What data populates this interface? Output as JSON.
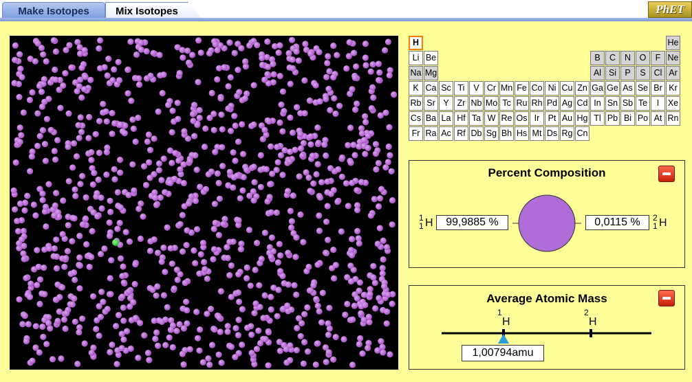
{
  "tabs": [
    {
      "label": "Make Isotopes",
      "active": false
    },
    {
      "label": "Mix Isotopes",
      "active": true
    }
  ],
  "logo": "PhET",
  "periodic_table": {
    "selected": "H",
    "rows": [
      [
        "H",
        "",
        "",
        "",
        "",
        "",
        "",
        "",
        "",
        "",
        "",
        "",
        "",
        "",
        "",
        "",
        "",
        "He"
      ],
      [
        "Li",
        "Be",
        "",
        "",
        "",
        "",
        "",
        "",
        "",
        "",
        "",
        "",
        "B",
        "C",
        "N",
        "O",
        "F",
        "Ne"
      ],
      [
        "Na",
        "Mg",
        "",
        "",
        "",
        "",
        "",
        "",
        "",
        "",
        "",
        "",
        "Al",
        "Si",
        "P",
        "S",
        "Cl",
        "Ar"
      ],
      [
        "K",
        "Ca",
        "Sc",
        "Ti",
        "V",
        "Cr",
        "Mn",
        "Fe",
        "Co",
        "Ni",
        "Cu",
        "Zn",
        "Ga",
        "Ge",
        "As",
        "Se",
        "Br",
        "Kr"
      ],
      [
        "Rb",
        "Sr",
        "Y",
        "Zr",
        "Nb",
        "Mo",
        "Tc",
        "Ru",
        "Rh",
        "Pd",
        "Ag",
        "Cd",
        "In",
        "Sn",
        "Sb",
        "Te",
        "I",
        "Xe"
      ],
      [
        "Cs",
        "Ba",
        "La",
        "Hf",
        "Ta",
        "W",
        "Re",
        "Os",
        "Ir",
        "Pt",
        "Au",
        "Hg",
        "Tl",
        "Pb",
        "Bi",
        "Po",
        "At",
        "Rn"
      ],
      [
        "Fr",
        "Ra",
        "Ac",
        "Rf",
        "Db",
        "Sg",
        "Bh",
        "Hs",
        "Mt",
        "Ds",
        "Rg",
        "Cn",
        "",
        "",
        "",
        "",
        "",
        ""
      ]
    ],
    "gray_elements": [
      "He",
      "B",
      "C",
      "N",
      "O",
      "F",
      "Ne",
      "Na",
      "Mg",
      "Al",
      "Si",
      "P",
      "S",
      "Cl",
      "Ar"
    ]
  },
  "chamber": {
    "atom_colors": {
      "h1": "#a64fc4",
      "h2": "#22c422"
    },
    "h2_count_visible": 1
  },
  "percent_composition": {
    "title": "Percent Composition",
    "left_isotope": {
      "mass": "1",
      "number": "1",
      "symbol": "H",
      "percent": "99,9885 %"
    },
    "right_isotope": {
      "mass": "2",
      "number": "1",
      "symbol": "H",
      "percent": "0,0115 %"
    },
    "pie_fractions": [
      0.999885,
      0.000115
    ],
    "pie_color": "#b06cd6"
  },
  "average_atomic_mass": {
    "title": "Average Atomic Mass",
    "isotopes": [
      {
        "mass": "1",
        "symbol": "H"
      },
      {
        "mass": "2",
        "symbol": "H"
      }
    ],
    "value": "1,00794amu",
    "indicator_color": "#2a9ddb"
  },
  "colors": {
    "background": "#ffff99",
    "chamber": "#000000",
    "accent_select": "#ff7a00"
  }
}
